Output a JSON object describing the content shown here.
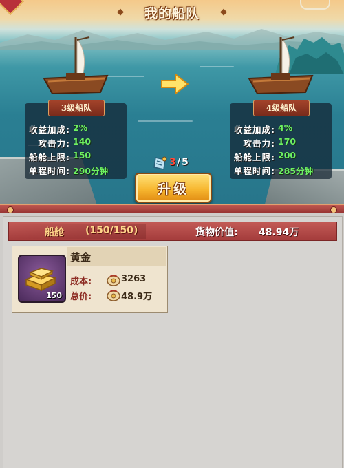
{
  "header": {
    "title": "我的船队"
  },
  "upgrade": {
    "button_label": "升级",
    "count_current": "3",
    "count_separator": "/",
    "count_max": "5"
  },
  "current_fleet": {
    "title": "3级船队",
    "stats": [
      {
        "label": "收益加成:",
        "value": "2%"
      },
      {
        "label": "攻击力:",
        "value": "140"
      },
      {
        "label": "船舱上限:",
        "value": "150"
      },
      {
        "label": "单程时间:",
        "value": "290分钟"
      }
    ]
  },
  "next_fleet": {
    "title": "4级船队",
    "stats": [
      {
        "label": "收益加成:",
        "value": "4%"
      },
      {
        "label": "攻击力:",
        "value": "170"
      },
      {
        "label": "船舱上限:",
        "value": "200"
      },
      {
        "label": "单程时间:",
        "value": "285分钟"
      }
    ]
  },
  "cargo": {
    "hold_label": "船舱",
    "hold_count": "(150/150)",
    "value_label": "货物价值:",
    "value_amount": "48.94万",
    "items": [
      {
        "name": "黄金",
        "quantity": "150",
        "cost_label": "成本:",
        "cost_value": "3263",
        "total_label": "总价:",
        "total_value": "48.9万",
        "icon": "gold-bars-icon",
        "coin_icon": "coin-pouch-icon"
      }
    ]
  },
  "colors": {
    "stat_value": "#6ef262",
    "stat_label": "#ffffff",
    "button_gold": "#f7b730",
    "hold_bar": "#a43c3c",
    "count_current": "#ff4a3a"
  }
}
